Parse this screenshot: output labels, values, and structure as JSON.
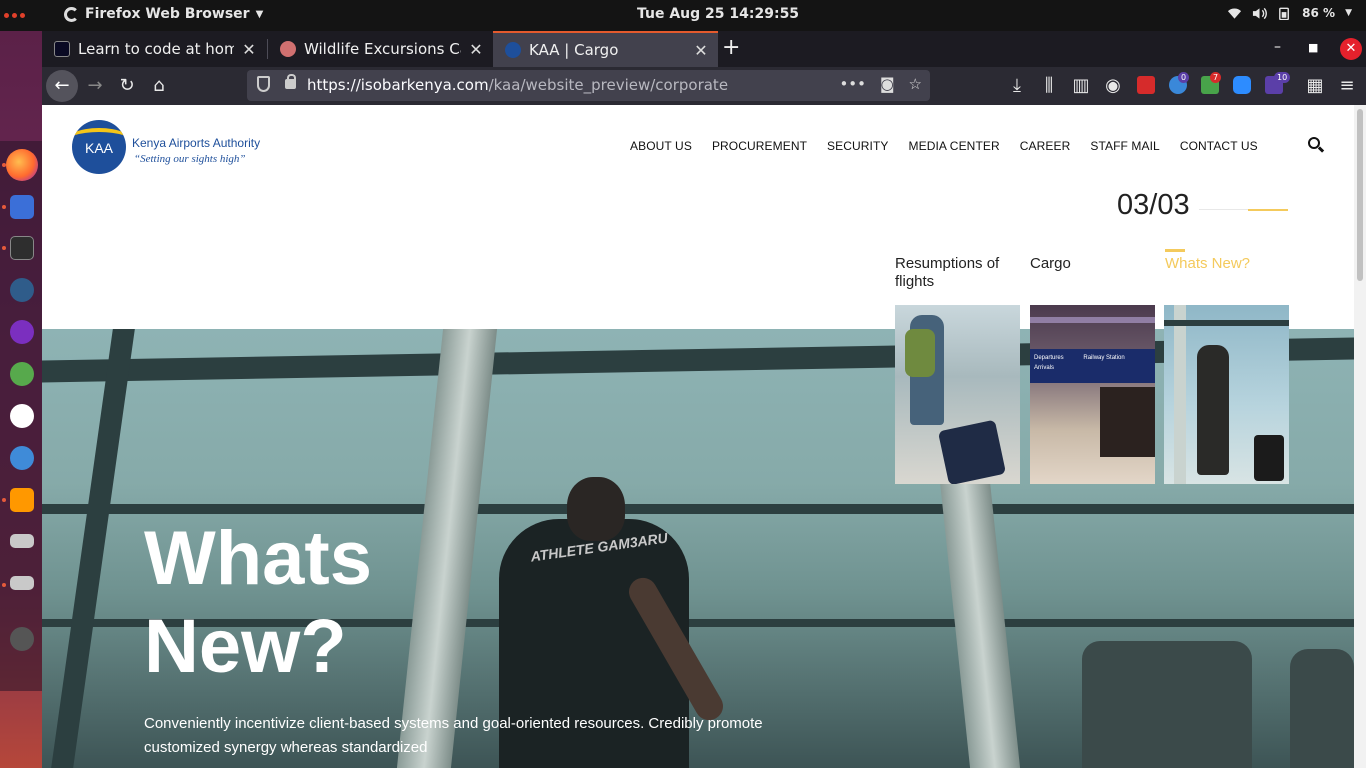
{
  "system": {
    "app_name": "Firefox Web Browser",
    "clock": "Tue Aug 25  14:29:55",
    "battery": "86 %"
  },
  "browser": {
    "tabs": [
      {
        "title": "Learn to code at home | f",
        "active": false
      },
      {
        "title": "Wildlife Excursions Camp",
        "active": false
      },
      {
        "title": "KAA | Cargo",
        "active": true
      }
    ],
    "url_host": "https://isobarkenya.com",
    "url_path": "/kaa/website_preview/corporate",
    "ext_badges": [
      "0",
      "7",
      "10"
    ]
  },
  "site": {
    "logo_text": "KAA",
    "org_name": "Kenya Airports Authority",
    "slogan": "“Setting our sights high”",
    "nav": [
      "ABOUT US",
      "PROCUREMENT",
      "SECURITY",
      "MEDIA CENTER",
      "CAREER",
      "STAFF MAIL",
      "CONTACT US"
    ],
    "slide_counter": "03/03",
    "slide_tabs": [
      {
        "label": "Resumptions of flights",
        "active": false
      },
      {
        "label": "Cargo",
        "active": false
      },
      {
        "label": "Whats New?",
        "active": true
      }
    ],
    "hero": {
      "title": "Whats New?",
      "text": "Conveniently incentivize client-based systems and goal-oriented resources. Credibly promote customized synergy whereas standardized",
      "shirt_text": "ATHLETE GAM3ARU"
    },
    "thumb_sign_departures": "Departures",
    "thumb_sign_arrivals": "Arrivals",
    "thumb_sign_railway": "Railway Station",
    "accent_color": "#f4ca5c",
    "brand_color": "#1e4f9b"
  }
}
